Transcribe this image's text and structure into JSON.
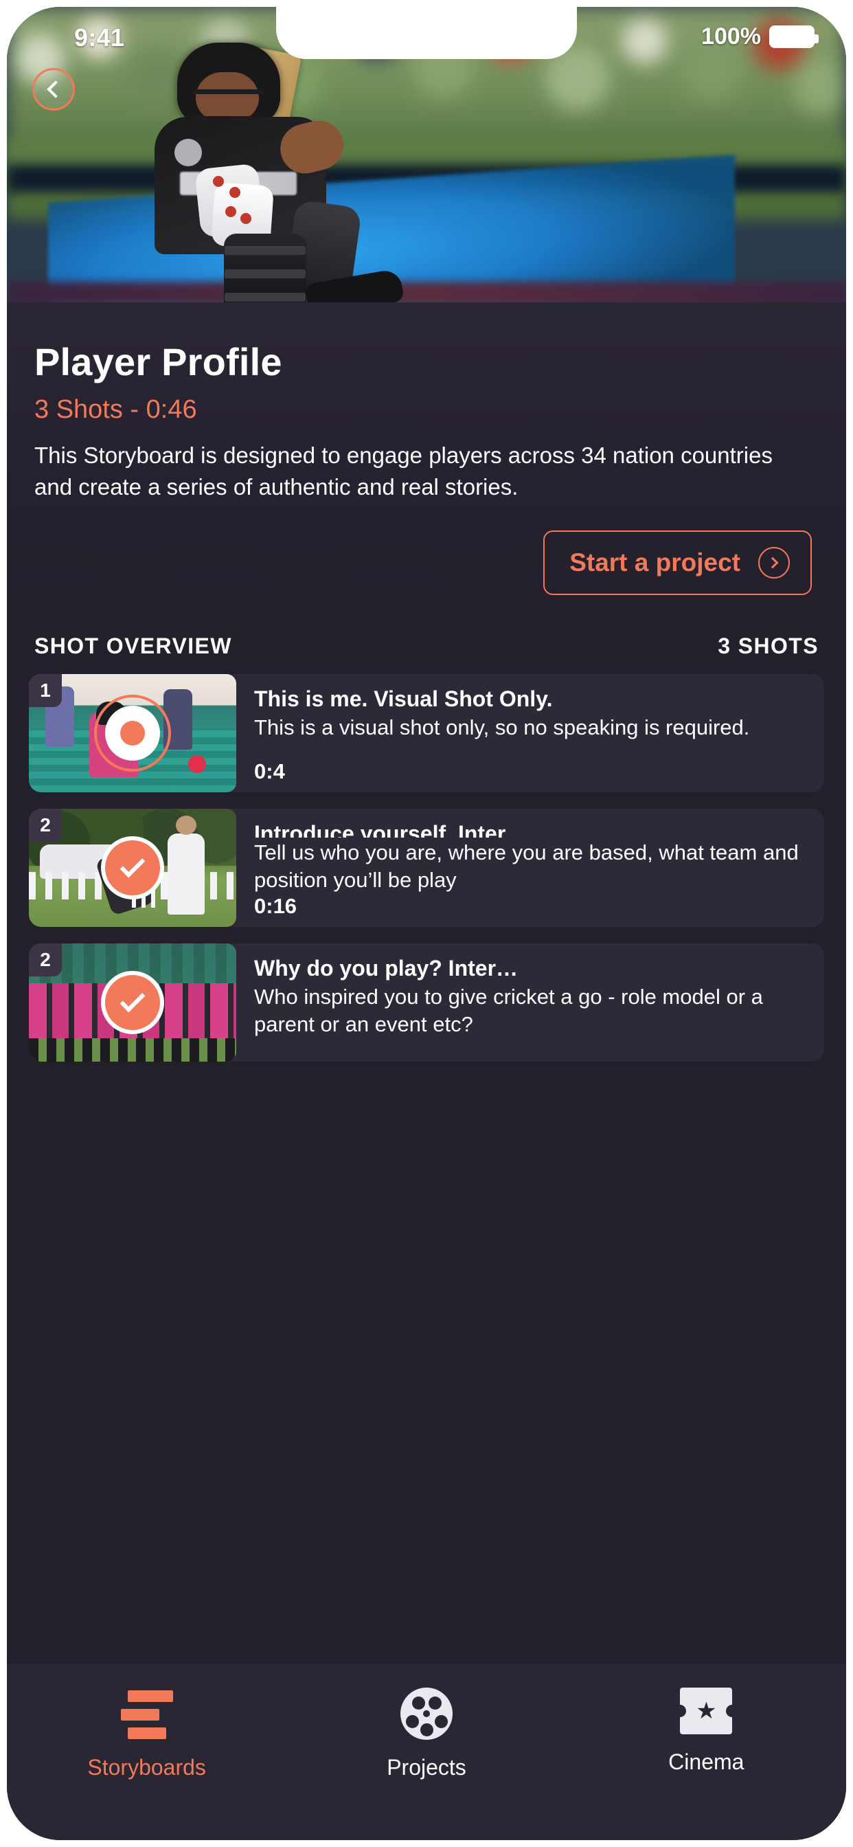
{
  "status_bar": {
    "time": "9:41",
    "battery_text": "100%",
    "battery_icon": "battery-full-icon"
  },
  "nav": {
    "back_icon": "chevron-left-icon"
  },
  "hero": {
    "alt": "cricket-batter-hero-image"
  },
  "detail": {
    "title": "Player Profile",
    "subtitle": "3 Shots - 0:46",
    "description": "This Storyboard is designed to engage players across 34 nation countries and create a series of authentic and real stories.",
    "cta_label": "Start a project",
    "cta_icon": "arrow-right-circle-icon"
  },
  "overview": {
    "heading": "SHOT OVERVIEW",
    "count": "3 SHOTS"
  },
  "shots": [
    {
      "index": "1",
      "title": "This is me. Visual Shot Only.",
      "description": "This is a visual shot only, so no speaking is required.",
      "duration": "0:4",
      "overlay_icon": "record-button-icon",
      "thumb": "batter-in-pink-thumbnail"
    },
    {
      "index": "2",
      "title": "Introduce yourself. Inter…",
      "description": "Tell us who you are, where you are based, what team and position you’ll be play",
      "duration": "0:16",
      "overlay_icon": "check-circle-icon",
      "thumb": "bowler-and-umpire-thumbnail"
    },
    {
      "index": "2",
      "title": "Why do you play? Inter…",
      "description": "Who inspired you to give cricket a go - role model or a parent or an event etc?",
      "duration": "",
      "overlay_icon": "check-circle-icon",
      "thumb": "team-photo-thumbnail"
    }
  ],
  "tabs": [
    {
      "label": "Storyboards",
      "icon": "storyboard-bars-icon",
      "active": true
    },
    {
      "label": "Projects",
      "icon": "film-reel-icon",
      "active": false
    },
    {
      "label": "Cinema",
      "icon": "ticket-star-icon",
      "active": false
    }
  ],
  "colors": {
    "accent": "#f2795a",
    "background": "#231f2b",
    "card": "#2e2937",
    "tabbar": "#2b2633",
    "text": "#ffffff"
  }
}
